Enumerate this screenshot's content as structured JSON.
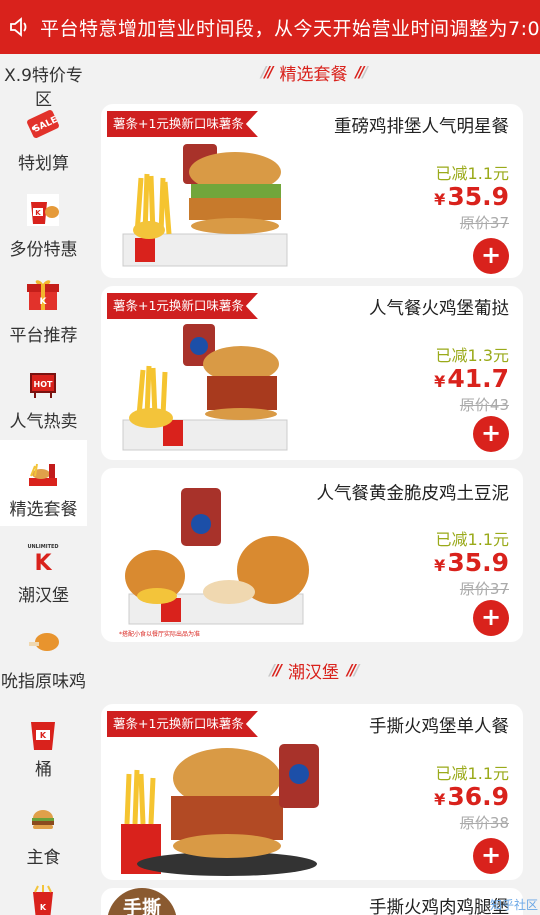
{
  "banner": {
    "text": "平台特意增加营业时间段，从今天开始营业时间调整为7:0"
  },
  "sidebar": {
    "items": [
      {
        "label": "X.9特价专区",
        "icon": "sale-tag-icon"
      },
      {
        "label": "特划算",
        "icon": "sale-tag-icon"
      },
      {
        "label": "多份特惠",
        "icon": "bucket-chicken-icon"
      },
      {
        "label": "平台推荐",
        "icon": "gift-box-icon"
      },
      {
        "label": "人气热卖",
        "icon": "hot-sign-icon"
      },
      {
        "label": "精选套餐",
        "icon": "combo-meal-icon"
      },
      {
        "label": "潮汉堡",
        "icon": "unlimited-logo-icon"
      },
      {
        "label": "吮指原味鸡",
        "icon": "fried-chicken-icon"
      },
      {
        "label": "桶",
        "icon": "bucket-icon"
      },
      {
        "label": "主食",
        "icon": "burger-icon"
      }
    ],
    "active": "精选套餐"
  },
  "sections": [
    {
      "title": "精选套餐"
    },
    {
      "title": "潮汉堡"
    }
  ],
  "products": [
    {
      "tag": "薯条+1元换新口味薯条",
      "name": "重磅鸡排堡人气明星餐",
      "discount": "已减1.1元",
      "currency": "¥",
      "price": "35.9",
      "original": "原价37"
    },
    {
      "tag": "薯条+1元换新口味薯条",
      "name": "人气餐火鸡堡葡挞",
      "discount": "已减1.3元",
      "currency": "¥",
      "price": "41.7",
      "original": "原价43"
    },
    {
      "tag": "",
      "name": "人气餐黄金脆皮鸡土豆泥",
      "discount": "已减1.1元",
      "currency": "¥",
      "price": "35.9",
      "original": "原价37",
      "note": "*搭配小食以餐厅实际出品为准"
    },
    {
      "tag": "薯条+1元换新口味薯条",
      "name": "手撕火鸡堡单人餐",
      "discount": "已减1.1元",
      "currency": "¥",
      "price": "36.9",
      "original": "原价38"
    },
    {
      "tag": "",
      "name": "手撕火鸡肉鸡腿堡",
      "badge": "手撕"
    }
  ],
  "add_label": "+",
  "watermark": "知乎社区",
  "colors": {
    "brand_red": "#d9221c",
    "discount_green": "#9aaa1a"
  }
}
